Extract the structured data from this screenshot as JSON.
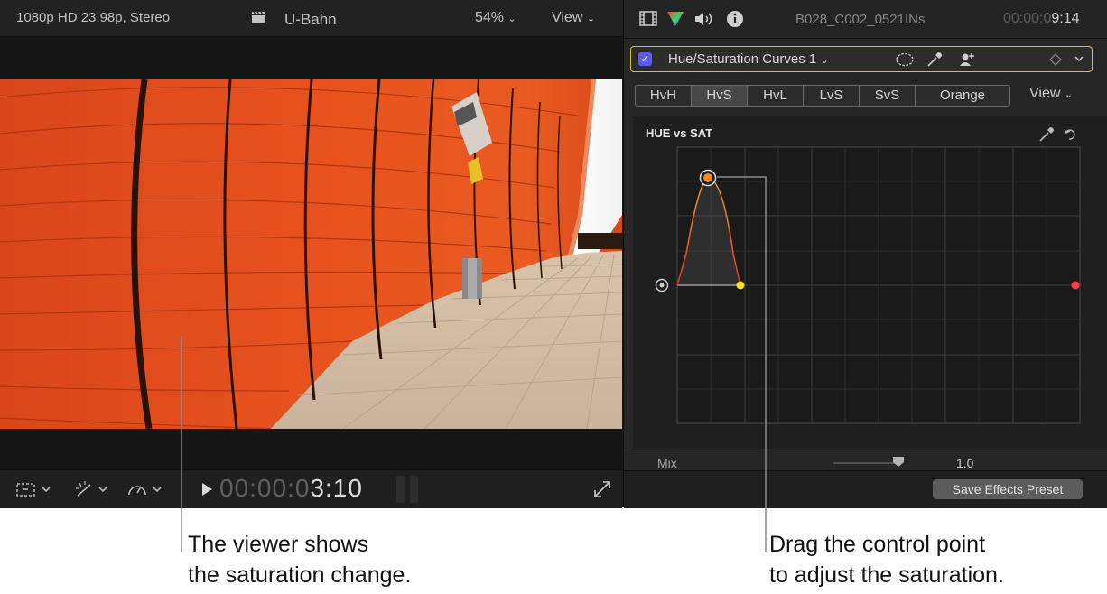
{
  "viewer": {
    "format": "1080p HD 23.98p, Stereo",
    "title": "U-Bahn",
    "zoom": "54%",
    "view_label": "View",
    "timecode_dim": "00:00:0",
    "timecode_bright": "3:10"
  },
  "inspector": {
    "clip_name": "B028_C002_0521INs",
    "timecode_dim": "00:00:0",
    "timecode_bright": "9:14",
    "effect": {
      "enabled": true,
      "name": "Hue/Saturation Curves 1"
    },
    "tabs": [
      {
        "label": "HvH",
        "selected": false
      },
      {
        "label": "HvS",
        "selected": true
      },
      {
        "label": "HvL",
        "selected": false
      },
      {
        "label": "LvS",
        "selected": false
      },
      {
        "label": "SvS",
        "selected": false
      },
      {
        "label": "Orange",
        "selected": false
      }
    ],
    "view_label": "View",
    "curve_title": "HUE vs SAT",
    "mix": {
      "label": "Mix",
      "value": "1.0"
    },
    "save_button": "Save Effects Preset"
  },
  "callouts": {
    "viewer_line1": "The viewer shows",
    "viewer_line2": "the saturation change.",
    "control_line1": "Drag the control point",
    "control_line2": "to adjust the saturation."
  },
  "colors": {
    "effect_header_border": "#d9c23a",
    "checkbox": "#5b5bf0",
    "control_point": "#f08a2a",
    "curve_anchor": "#f5e033",
    "curve_end": "#ff3b4a"
  }
}
